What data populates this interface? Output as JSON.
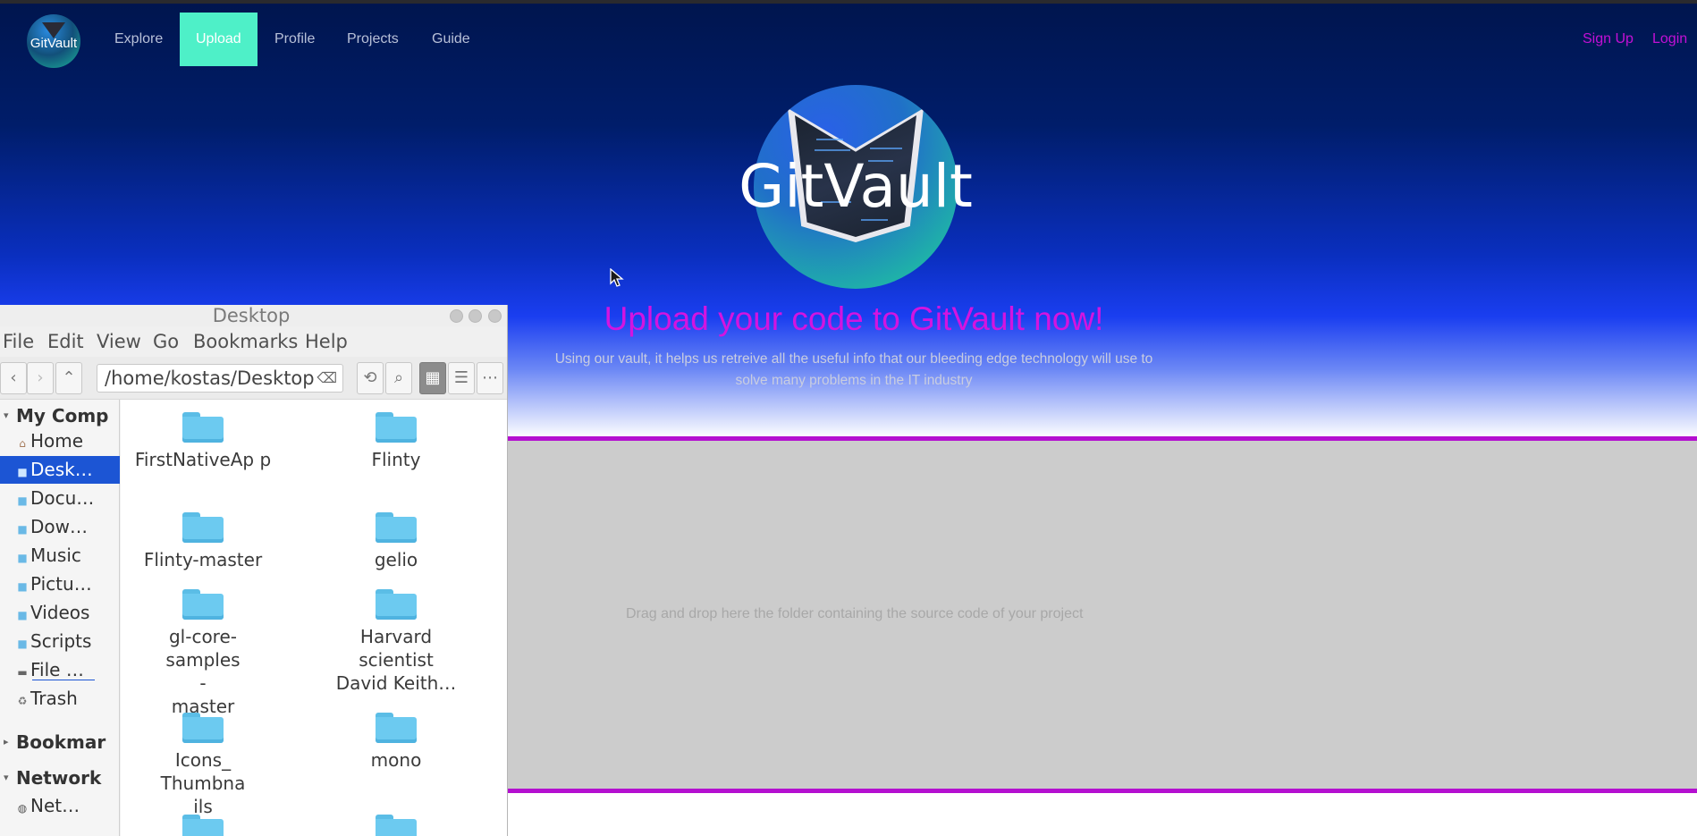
{
  "website": {
    "logo_text": "GitVault",
    "nav": [
      {
        "label": "Explore"
      },
      {
        "label": "Upload",
        "active": true
      },
      {
        "label": "Profile"
      },
      {
        "label": "Projects"
      },
      {
        "label": "Guide"
      }
    ],
    "auth": {
      "signup": "Sign Up",
      "login": "Login"
    },
    "hero_title": "GitVault",
    "headline": "Upload your code to GitVault now!",
    "subtext": "Using our vault, it helps us retreive all the useful info that our bleeding edge technology will use to solve many problems in the IT industry",
    "dropzone_text": "Drag and drop here the folder containing the source code of your project",
    "colors": {
      "accent": "#c410d6",
      "active_nav": "#4ef0c8",
      "hero_dark": "#00154e",
      "dropzone": "#cccccc"
    }
  },
  "file_manager": {
    "title": "Desktop",
    "menu": [
      "File",
      "Edit",
      "View",
      "Go",
      "Bookmarks",
      "Help"
    ],
    "path": "/home/kostas/Desktop",
    "sidebar": {
      "my_computer": "My Comp",
      "places": [
        {
          "label": "Home",
          "icon": "home-icon"
        },
        {
          "label": "Desk…",
          "icon": "folder-icon",
          "selected": true
        },
        {
          "label": "Docu…",
          "icon": "folder-icon"
        },
        {
          "label": "Dow…",
          "icon": "folder-icon"
        },
        {
          "label": "Music",
          "icon": "folder-icon"
        },
        {
          "label": "Pictu…",
          "icon": "folder-icon"
        },
        {
          "label": "Videos",
          "icon": "folder-icon"
        },
        {
          "label": "Scripts",
          "icon": "folder-icon"
        },
        {
          "label": "File …",
          "icon": "drive-icon"
        },
        {
          "label": "Trash",
          "icon": "trash-icon"
        }
      ],
      "bookmarks": "Bookmar",
      "network": "Network",
      "network_items": [
        {
          "label": "Net…",
          "icon": "network-icon"
        }
      ]
    },
    "files": [
      {
        "name": "FirstNativeAp p"
      },
      {
        "name": "Flinty"
      },
      {
        "name": "Flinty-master"
      },
      {
        "name": "gelio"
      },
      {
        "name": "gl-core- samples- master"
      },
      {
        "name": "Harvard scientist David Keith…"
      },
      {
        "name": "Icons_ Thumbnails"
      },
      {
        "name": "mono"
      },
      {
        "name": ""
      },
      {
        "name": ""
      }
    ]
  }
}
